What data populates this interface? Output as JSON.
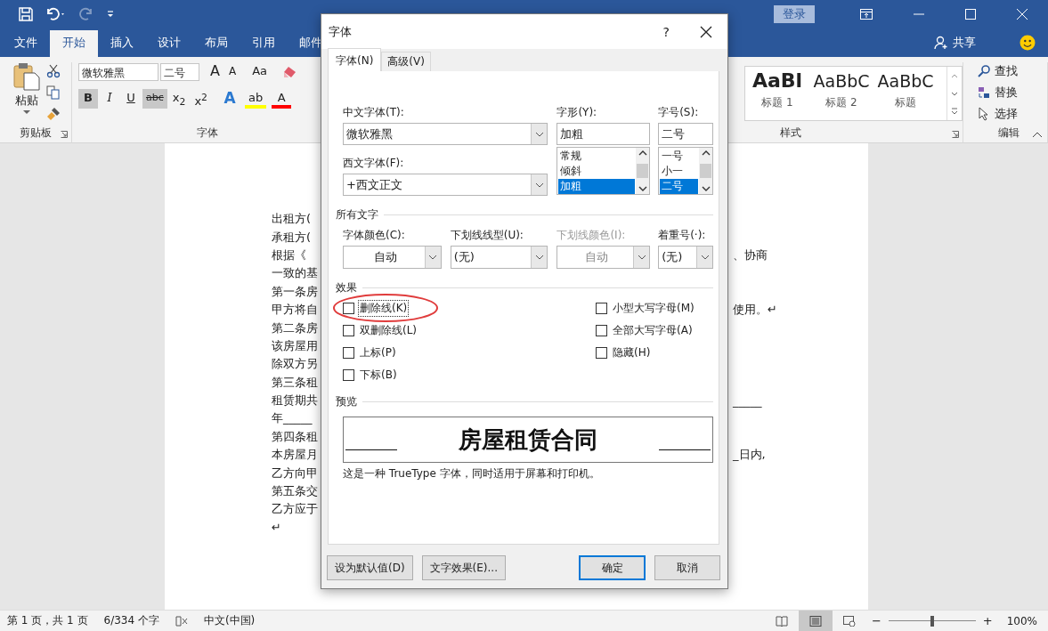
{
  "window": {
    "quick_access": [
      {
        "kind": "save",
        "disabled": false
      },
      {
        "kind": "undo",
        "disabled": false
      },
      {
        "kind": "redo",
        "disabled": true
      },
      {
        "kind": "customize",
        "disabled": false
      }
    ],
    "sign_in": "登录",
    "share": "共享"
  },
  "ribbon_tabs": [
    {
      "label": "文件",
      "selected": false
    },
    {
      "label": "开始",
      "selected": true
    },
    {
      "label": "插入",
      "selected": false
    },
    {
      "label": "设计",
      "selected": false
    },
    {
      "label": "布局",
      "selected": false
    },
    {
      "label": "引用",
      "selected": false
    },
    {
      "label": "邮件",
      "selected": false
    }
  ],
  "clipboard": {
    "paste": "粘贴",
    "group": "剪贴板"
  },
  "font_group": {
    "font": "微软雅黑",
    "size": "二号",
    "row1": [
      {
        "kind": "grow",
        "label": "A"
      },
      {
        "kind": "shrink",
        "label": "A"
      },
      {
        "kind": "case",
        "label": "Aa"
      },
      {
        "kind": "clear"
      }
    ],
    "row2": [
      {
        "kind": "bold",
        "label": "B",
        "pressed": true
      },
      {
        "kind": "italic",
        "label": "I",
        "pressed": false
      },
      {
        "kind": "underline",
        "label": "U",
        "pressed": false
      },
      {
        "kind": "strike",
        "label": "abc",
        "pressed": true
      },
      {
        "kind": "script",
        "label": "x$_{2}$",
        "pressed": false
      },
      {
        "kind": "script",
        "label": "x$^{2}$",
        "pressed": false
      },
      {
        "kind": "effect",
        "label": "A",
        "pressed": false
      },
      {
        "kind": "highlight",
        "label": "ab",
        "pressed": false,
        "color": "#ffff00"
      },
      {
        "kind": "fontcolor",
        "label": "A",
        "pressed": false,
        "color": "#ff0000"
      }
    ],
    "group": "字体"
  },
  "styles": {
    "items": [
      {
        "kind": "heading1",
        "sample": "AaBl",
        "name": "标题 1"
      },
      {
        "kind": "heading2",
        "sample": "AaBbC",
        "name": "标题 2"
      },
      {
        "kind": "title",
        "sample": "AaBbC",
        "name": "标题"
      }
    ],
    "group": "样式"
  },
  "editing": {
    "items": [
      {
        "kind": "find",
        "label": "查找"
      },
      {
        "kind": "replace",
        "label": "替换"
      },
      {
        "kind": "select",
        "label": "选择"
      }
    ],
    "group": "编辑"
  },
  "document": {
    "lines": [
      {
        "left": "出租方("
      },
      {
        "left": "承租方("
      },
      {
        "left": "根据《",
        "right": "、协商"
      },
      {
        "left": "一致的基"
      },
      {
        "left": "第一条房"
      },
      {
        "left": "甲方将自",
        "right": "使用。↵"
      },
      {
        "left": "第二条房"
      },
      {
        "left": "该房屋用"
      },
      {
        "left": "除双方另"
      },
      {
        "left": "第三条租"
      },
      {
        "left": "租赁期共",
        "right": "_____"
      },
      {
        "left": "年_____"
      },
      {
        "left": "第四条租"
      },
      {
        "left": "本房屋月",
        "right": "_日内,"
      },
      {
        "left": "乙方向甲"
      },
      {
        "left": "第五条交"
      },
      {
        "left": "乙方应于"
      },
      {
        "left": "↵"
      }
    ]
  },
  "dialog": {
    "title": "字体",
    "help": "?",
    "tabs": [
      {
        "label": "字体(N)",
        "selected": true
      },
      {
        "label": "高级(V)",
        "selected": false
      }
    ],
    "chinese_font": {
      "label": "中文字体(T):",
      "value": "微软雅黑"
    },
    "western_font": {
      "label": "西文字体(F):",
      "value": "+西文正文"
    },
    "style": {
      "label": "字形(Y):",
      "value": "加粗",
      "options": [
        {
          "label": "常规",
          "selected": false
        },
        {
          "label": "倾斜",
          "selected": false
        },
        {
          "label": "加粗",
          "selected": true
        }
      ]
    },
    "size": {
      "label": "字号(S):",
      "value": "二号",
      "options": [
        {
          "label": "一号",
          "selected": false
        },
        {
          "label": "小一",
          "selected": false
        },
        {
          "label": "二号",
          "selected": true
        }
      ]
    },
    "all_text": {
      "heading": "所有文字",
      "fields": [
        {
          "kind": "color",
          "label": "字体颜色(C):",
          "value": "自动",
          "disabled": false
        },
        {
          "kind": "underline",
          "label": "下划线线型(U):",
          "value": "(无)",
          "disabled": false
        },
        {
          "kind": "color",
          "label": "下划线颜色(I):",
          "value": "自动",
          "disabled": true
        },
        {
          "kind": "emphasis",
          "label": "着重号(·):",
          "value": "(无)",
          "disabled": false
        }
      ]
    },
    "effects": {
      "heading": "效果",
      "left": [
        {
          "label": "删除线(K)",
          "checked": false,
          "focused": true,
          "highlighted": true
        },
        {
          "label": "双删除线(L)",
          "checked": false,
          "focused": false,
          "highlighted": false
        },
        {
          "label": "上标(P)",
          "checked": false,
          "focused": false,
          "highlighted": false
        },
        {
          "label": "下标(B)",
          "checked": false,
          "focused": false,
          "highlighted": false
        }
      ],
      "right": [
        {
          "label": "小型大写字母(M)",
          "checked": false,
          "focused": false,
          "highlighted": false
        },
        {
          "label": "全部大写字母(A)",
          "checked": false,
          "focused": false,
          "highlighted": false
        },
        {
          "label": "隐藏(H)",
          "checked": false,
          "focused": false,
          "highlighted": false
        }
      ]
    },
    "preview": {
      "heading": "预览",
      "sample": "房屋租赁合同",
      "note": "这是一种 TrueType 字体，同时适用于屏幕和打印机。"
    },
    "buttons": [
      {
        "label": "设为默认值(D)",
        "default": false
      },
      {
        "label": "文字效果(E)...",
        "default": false
      },
      {
        "label": "确定",
        "default": true
      },
      {
        "label": "取消",
        "default": false
      }
    ]
  },
  "status_bar": {
    "page": "第 1 页，共 1 页",
    "words": "6/334 个字",
    "language": "中文(中国)",
    "views": [
      {
        "kind": "read",
        "selected": false
      },
      {
        "kind": "print",
        "selected": true
      },
      {
        "kind": "web",
        "selected": false
      }
    ],
    "zoom": {
      "minus": "−",
      "plus": "+",
      "level": 0.5,
      "reading": "100%"
    }
  }
}
